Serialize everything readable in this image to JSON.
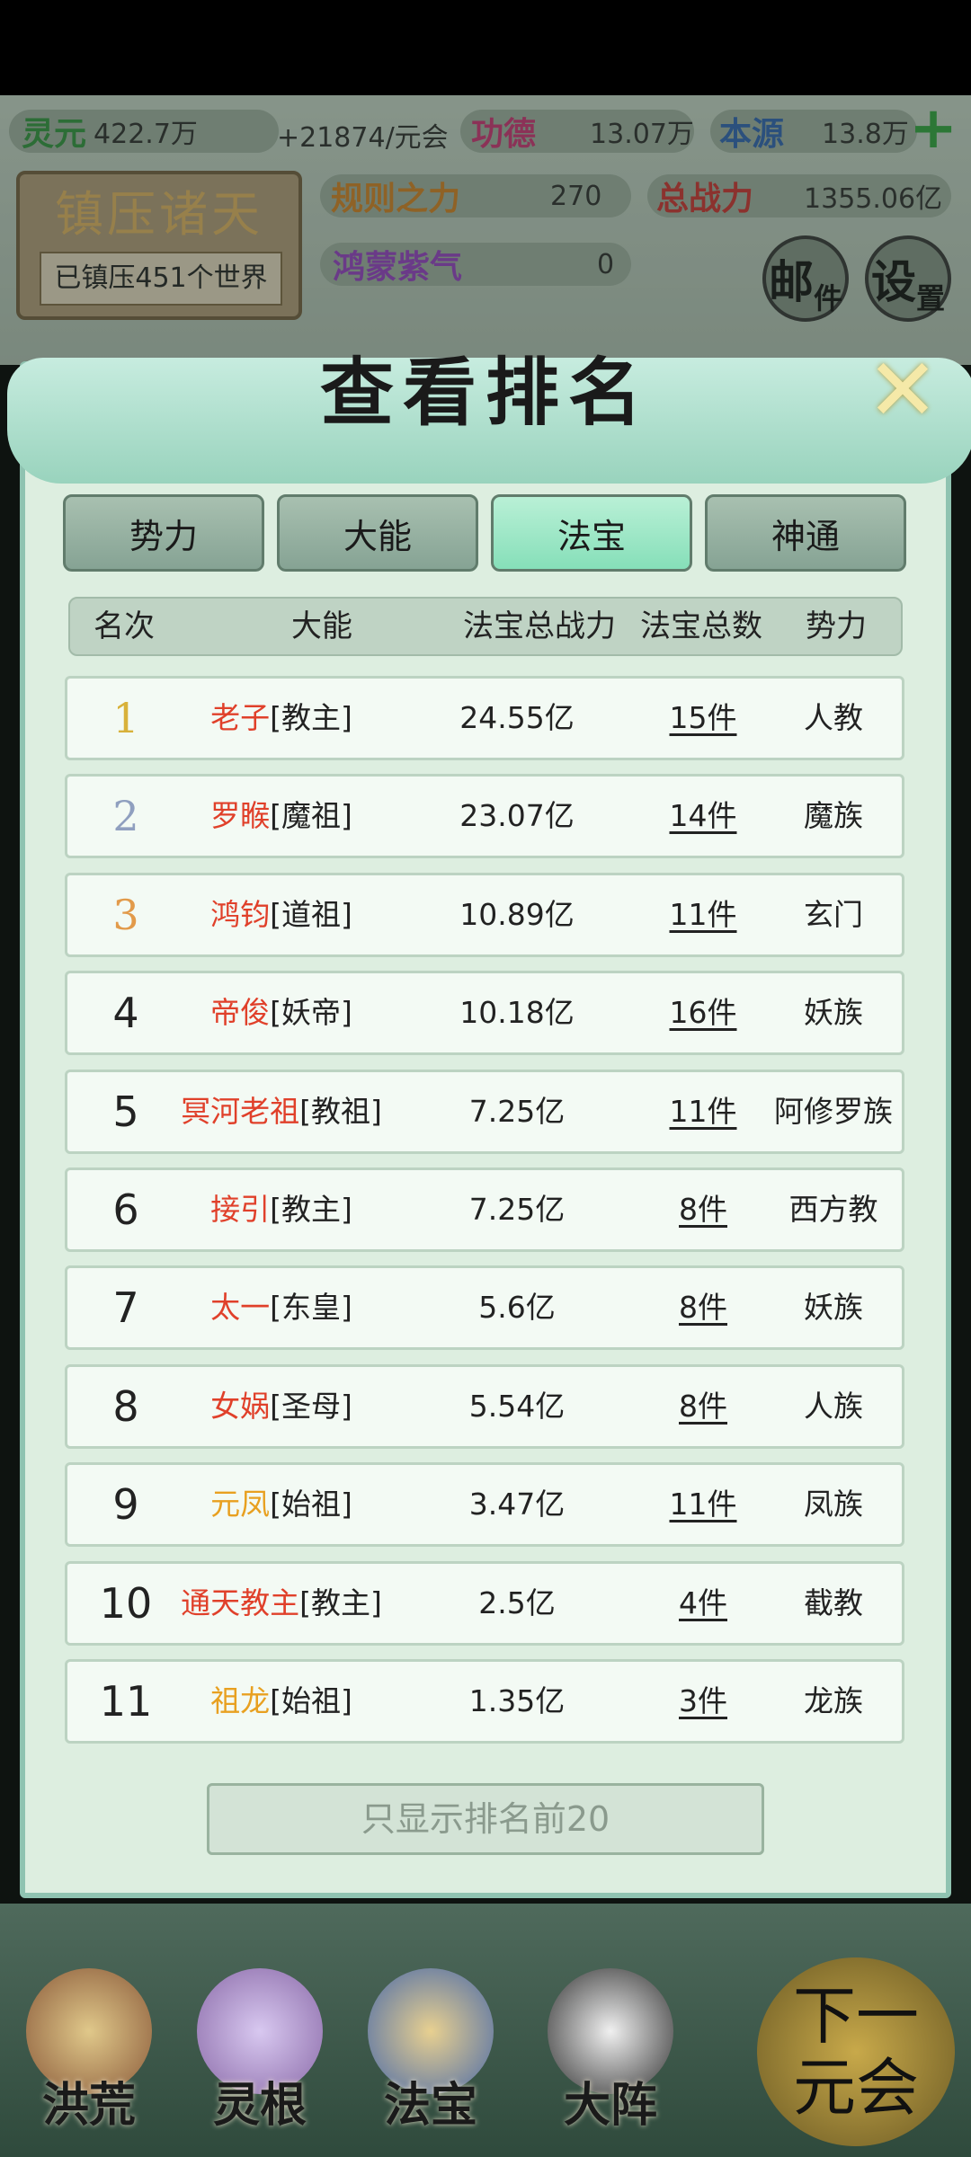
{
  "hud": {
    "lingyuan_label": "灵元",
    "lingyuan_value": "422.7万",
    "rate": "+21874/元会",
    "gongde_label": "功德",
    "gongde_value": "13.07万",
    "benyuan_label": "本源",
    "benyuan_value": "13.8万",
    "guize_label": "规则之力",
    "guize_value": "270",
    "zongzhanli_label": "总战力",
    "zongzhanli_value": "1355.06亿",
    "hongmeng_label": "鸿蒙紫气",
    "hongmeng_value": "0",
    "seal_title": "镇压诸天",
    "seal_sub": "已镇压451个世界",
    "mail": "邮",
    "mail_sub": "件",
    "settings": "设",
    "settings_sub": "置"
  },
  "dialog": {
    "title": "查看排名",
    "close": "✕",
    "tabs": [
      "势力",
      "大能",
      "法宝",
      "神通"
    ],
    "active_tab": "法宝",
    "headers": [
      "名次",
      "大能",
      "法宝总战力",
      "法宝总数",
      "势力"
    ],
    "rows": [
      {
        "rank": "1",
        "name": "老子",
        "title": "[教主]",
        "power": "24.55亿",
        "count": "15件",
        "faction": "人教"
      },
      {
        "rank": "2",
        "name": "罗睺",
        "title": "[魔祖]",
        "power": "23.07亿",
        "count": "14件",
        "faction": "魔族"
      },
      {
        "rank": "3",
        "name": "鸿钧",
        "title": "[道祖]",
        "power": "10.89亿",
        "count": "11件",
        "faction": "玄门"
      },
      {
        "rank": "4",
        "name": "帝俊",
        "title": "[妖帝]",
        "power": "10.18亿",
        "count": "16件",
        "faction": "妖族"
      },
      {
        "rank": "5",
        "name": "冥河老祖",
        "title": "[教祖]",
        "power": "7.25亿",
        "count": "11件",
        "faction": "阿修罗族"
      },
      {
        "rank": "6",
        "name": "接引",
        "title": "[教主]",
        "power": "7.25亿",
        "count": "8件",
        "faction": "西方教"
      },
      {
        "rank": "7",
        "name": "太一",
        "title": "[东皇]",
        "power": "5.6亿",
        "count": "8件",
        "faction": "妖族"
      },
      {
        "rank": "8",
        "name": "女娲",
        "title": "[圣母]",
        "power": "5.54亿",
        "count": "8件",
        "faction": "人族"
      },
      {
        "rank": "9",
        "name": "元凤",
        "title": "[始祖]",
        "power": "3.47亿",
        "count": "11件",
        "faction": "凤族"
      },
      {
        "rank": "10",
        "name": "通天教主",
        "title": "[教主]",
        "power": "2.5亿",
        "count": "4件",
        "faction": "截教"
      },
      {
        "rank": "11",
        "name": "祖龙",
        "title": "[始祖]",
        "power": "1.35亿",
        "count": "3件",
        "faction": "龙族"
      }
    ],
    "filter_button": "只显示排名前20"
  },
  "nav": {
    "items": [
      "洪荒",
      "灵根",
      "法宝",
      "大阵"
    ],
    "next_line1": "下一",
    "next_line2": "元会"
  },
  "colors": {
    "name_red": "#e0402a",
    "name_gold": "#e8a020",
    "active_tab": "#9ee6c4",
    "dialog_bg": "#ddeee0"
  }
}
